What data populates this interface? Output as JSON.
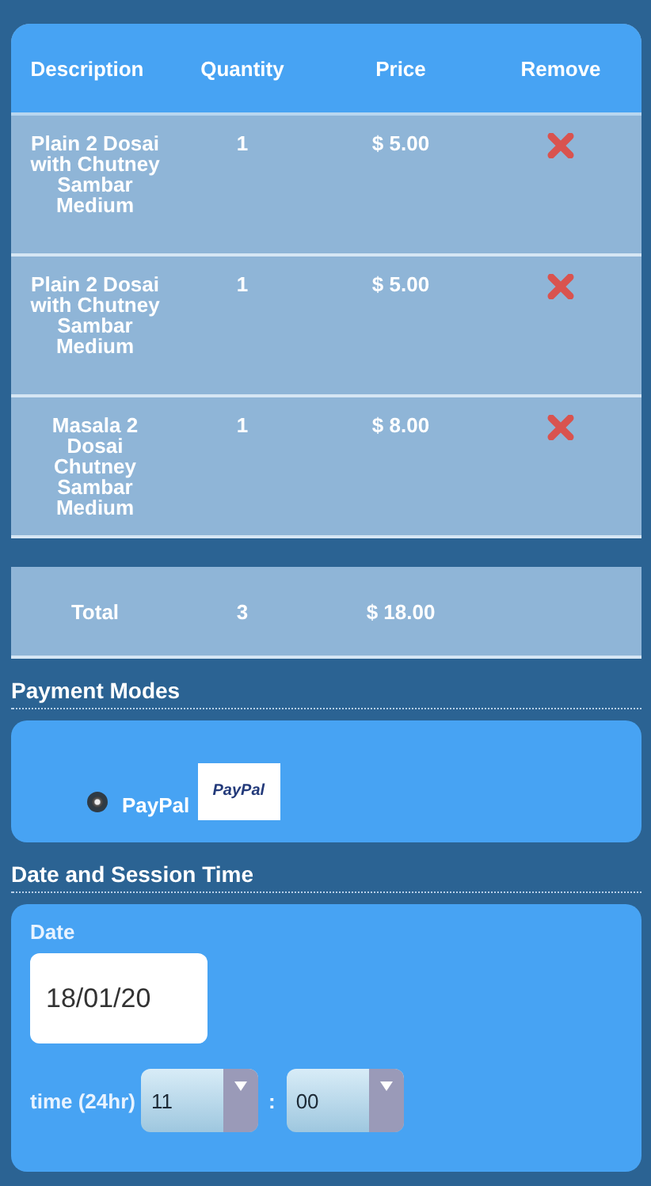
{
  "table": {
    "columns": [
      "Description",
      "Quantity",
      "Price",
      "Remove"
    ],
    "rows": [
      {
        "description": "Plain 2 Dosai with Chutney Sambar Medium",
        "quantity": "1",
        "price": "$ 5.00"
      },
      {
        "description": "Plain 2 Dosai with Chutney Sambar Medium",
        "quantity": "1",
        "price": "$ 5.00"
      },
      {
        "description": "Masala 2 Dosai Chutney Sambar Medium",
        "quantity": "1",
        "price": "$ 8.00"
      }
    ],
    "total": {
      "label": "Total",
      "quantity": "3",
      "price": "$ 18.00"
    }
  },
  "payment": {
    "heading": "Payment Modes",
    "options": [
      {
        "label": "PayPal",
        "logo": "PayPal",
        "selected": true
      }
    ]
  },
  "session": {
    "heading": "Date and Session Time",
    "date_label": "Date",
    "date_value": "18/01/20",
    "time_label": "time (24hr)",
    "hour": "11",
    "separator": ":",
    "minute": "00"
  }
}
